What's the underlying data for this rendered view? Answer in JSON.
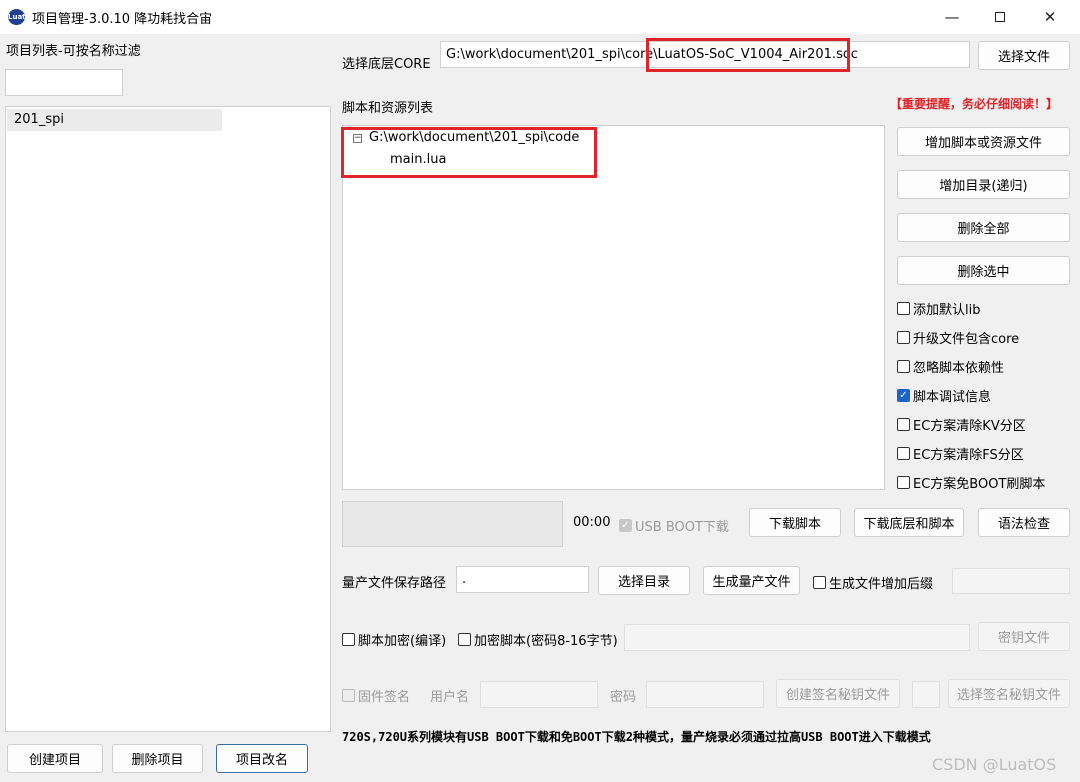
{
  "window": {
    "app_icon_text": "Luat",
    "title": "项目管理-3.0.10 降功耗找合宙"
  },
  "left": {
    "filter_label": "项目列表-可按名称过滤",
    "projects": [
      "201_spi"
    ],
    "create_btn": "创建项目",
    "delete_btn": "删除项目",
    "rename_btn": "项目改名"
  },
  "core": {
    "label": "选择底层CORE",
    "path_value": "G:\\work\\document\\201_spi\\core\\LuatOS-SoC_V1004_Air201.soc",
    "path_dir": "G:\\work\\document\\201_spi\\core\\",
    "path_file": "LuatOS-SoC_V1004_Air201.soc",
    "select_btn": "选择文件"
  },
  "scripts": {
    "label": "脚本和资源列表",
    "warning": "【重要提醒，务必仔细阅读！】",
    "tree_root": "G:\\work\\document\\201_spi\\code",
    "tree_children": [
      "main.lua"
    ]
  },
  "side_buttons": {
    "add_file": "增加脚本或资源文件",
    "add_dir": "增加目录(递归)",
    "delete_all": "删除全部",
    "delete_selected": "删除选中"
  },
  "options": [
    {
      "label": "添加默认lib",
      "checked": false
    },
    {
      "label": "升级文件包含core",
      "checked": false
    },
    {
      "label": "忽略脚本依赖性",
      "checked": false
    },
    {
      "label": "脚本调试信息",
      "checked": true
    },
    {
      "label": "EC方案清除KV分区",
      "checked": false
    },
    {
      "label": "EC方案清除FS分区",
      "checked": false
    },
    {
      "label": "EC方案免BOOT刷脚本",
      "checked": false
    }
  ],
  "download": {
    "timer": "00:00",
    "usb_boot_label": "USB BOOT下载",
    "download_script_btn": "下载脚本",
    "download_all_btn": "下载底层和脚本",
    "syntax_btn": "语法检查"
  },
  "production": {
    "label": "量产文件保存路径",
    "path_value": ".",
    "select_dir_btn": "选择目录",
    "generate_btn": "生成量产文件",
    "suffix_label": "生成文件增加后缀"
  },
  "encrypt": {
    "compile_label": "脚本加密(编译)",
    "password_label": "加密脚本(密码8-16字节)",
    "key_btn": "密钥文件"
  },
  "signature": {
    "firmware_sign_label": "固件签名",
    "username_label": "用户名",
    "password_label": "密码",
    "create_key_btn": "创建签名秘钥文件",
    "select_key_btn": "选择签名秘钥文件"
  },
  "footer_note": "720S,720U系列模块有USB BOOT下载和免BOOT下载2种模式，量产烧录必须通过拉高USB BOOT进入下载模式",
  "watermark": "CSDN @LuatOS",
  "colors": {
    "highlight_red": "#e0242a",
    "warning_red": "#e0242a",
    "checkbox_blue": "#1a64c8"
  }
}
